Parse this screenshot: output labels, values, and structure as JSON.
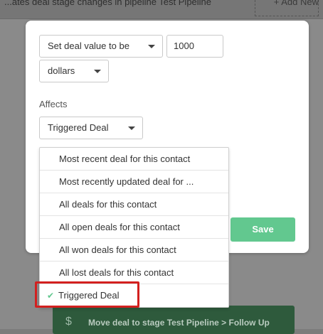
{
  "background": {
    "topbar_text": "...ates deal stage changes in pipeline Test Pipeline",
    "topbar_right": "+ Add New",
    "bottom_action_text": "Move deal to stage Test Pipeline > Follow Up"
  },
  "modal": {
    "action_select": "Set deal value to be",
    "value_input": "1000",
    "currency_select": "dollars",
    "affects_label": "Affects",
    "affects_select": "Triggered Deal",
    "save_label": "Save"
  },
  "dropdown": {
    "items": [
      "Most recent deal for this contact",
      "Most recently updated deal for ...",
      "All deals for this contact",
      "All open deals for this contact",
      "All won deals for this contact",
      "All lost deals for this contact",
      "Triggered Deal"
    ],
    "selected_index": 6,
    "check_icon": "check-icon"
  },
  "colors": {
    "accent_green": "#62c88f",
    "highlight_red": "#d3201f"
  }
}
